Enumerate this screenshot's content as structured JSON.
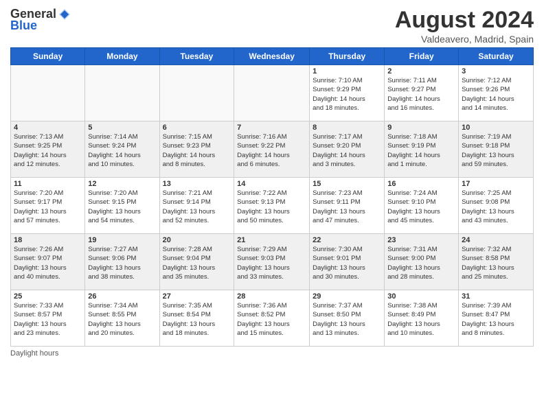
{
  "logo": {
    "general": "General",
    "blue": "Blue"
  },
  "title": "August 2024",
  "subtitle": "Valdeavero, Madrid, Spain",
  "days_of_week": [
    "Sunday",
    "Monday",
    "Tuesday",
    "Wednesday",
    "Thursday",
    "Friday",
    "Saturday"
  ],
  "footer": "Daylight hours",
  "weeks": [
    [
      {
        "day": "",
        "info": ""
      },
      {
        "day": "",
        "info": ""
      },
      {
        "day": "",
        "info": ""
      },
      {
        "day": "",
        "info": ""
      },
      {
        "day": "1",
        "info": "Sunrise: 7:10 AM\nSunset: 9:29 PM\nDaylight: 14 hours\nand 18 minutes."
      },
      {
        "day": "2",
        "info": "Sunrise: 7:11 AM\nSunset: 9:27 PM\nDaylight: 14 hours\nand 16 minutes."
      },
      {
        "day": "3",
        "info": "Sunrise: 7:12 AM\nSunset: 9:26 PM\nDaylight: 14 hours\nand 14 minutes."
      }
    ],
    [
      {
        "day": "4",
        "info": "Sunrise: 7:13 AM\nSunset: 9:25 PM\nDaylight: 14 hours\nand 12 minutes."
      },
      {
        "day": "5",
        "info": "Sunrise: 7:14 AM\nSunset: 9:24 PM\nDaylight: 14 hours\nand 10 minutes."
      },
      {
        "day": "6",
        "info": "Sunrise: 7:15 AM\nSunset: 9:23 PM\nDaylight: 14 hours\nand 8 minutes."
      },
      {
        "day": "7",
        "info": "Sunrise: 7:16 AM\nSunset: 9:22 PM\nDaylight: 14 hours\nand 6 minutes."
      },
      {
        "day": "8",
        "info": "Sunrise: 7:17 AM\nSunset: 9:20 PM\nDaylight: 14 hours\nand 3 minutes."
      },
      {
        "day": "9",
        "info": "Sunrise: 7:18 AM\nSunset: 9:19 PM\nDaylight: 14 hours\nand 1 minute."
      },
      {
        "day": "10",
        "info": "Sunrise: 7:19 AM\nSunset: 9:18 PM\nDaylight: 13 hours\nand 59 minutes."
      }
    ],
    [
      {
        "day": "11",
        "info": "Sunrise: 7:20 AM\nSunset: 9:17 PM\nDaylight: 13 hours\nand 57 minutes."
      },
      {
        "day": "12",
        "info": "Sunrise: 7:20 AM\nSunset: 9:15 PM\nDaylight: 13 hours\nand 54 minutes."
      },
      {
        "day": "13",
        "info": "Sunrise: 7:21 AM\nSunset: 9:14 PM\nDaylight: 13 hours\nand 52 minutes."
      },
      {
        "day": "14",
        "info": "Sunrise: 7:22 AM\nSunset: 9:13 PM\nDaylight: 13 hours\nand 50 minutes."
      },
      {
        "day": "15",
        "info": "Sunrise: 7:23 AM\nSunset: 9:11 PM\nDaylight: 13 hours\nand 47 minutes."
      },
      {
        "day": "16",
        "info": "Sunrise: 7:24 AM\nSunset: 9:10 PM\nDaylight: 13 hours\nand 45 minutes."
      },
      {
        "day": "17",
        "info": "Sunrise: 7:25 AM\nSunset: 9:08 PM\nDaylight: 13 hours\nand 43 minutes."
      }
    ],
    [
      {
        "day": "18",
        "info": "Sunrise: 7:26 AM\nSunset: 9:07 PM\nDaylight: 13 hours\nand 40 minutes."
      },
      {
        "day": "19",
        "info": "Sunrise: 7:27 AM\nSunset: 9:06 PM\nDaylight: 13 hours\nand 38 minutes."
      },
      {
        "day": "20",
        "info": "Sunrise: 7:28 AM\nSunset: 9:04 PM\nDaylight: 13 hours\nand 35 minutes."
      },
      {
        "day": "21",
        "info": "Sunrise: 7:29 AM\nSunset: 9:03 PM\nDaylight: 13 hours\nand 33 minutes."
      },
      {
        "day": "22",
        "info": "Sunrise: 7:30 AM\nSunset: 9:01 PM\nDaylight: 13 hours\nand 30 minutes."
      },
      {
        "day": "23",
        "info": "Sunrise: 7:31 AM\nSunset: 9:00 PM\nDaylight: 13 hours\nand 28 minutes."
      },
      {
        "day": "24",
        "info": "Sunrise: 7:32 AM\nSunset: 8:58 PM\nDaylight: 13 hours\nand 25 minutes."
      }
    ],
    [
      {
        "day": "25",
        "info": "Sunrise: 7:33 AM\nSunset: 8:57 PM\nDaylight: 13 hours\nand 23 minutes."
      },
      {
        "day": "26",
        "info": "Sunrise: 7:34 AM\nSunset: 8:55 PM\nDaylight: 13 hours\nand 20 minutes."
      },
      {
        "day": "27",
        "info": "Sunrise: 7:35 AM\nSunset: 8:54 PM\nDaylight: 13 hours\nand 18 minutes."
      },
      {
        "day": "28",
        "info": "Sunrise: 7:36 AM\nSunset: 8:52 PM\nDaylight: 13 hours\nand 15 minutes."
      },
      {
        "day": "29",
        "info": "Sunrise: 7:37 AM\nSunset: 8:50 PM\nDaylight: 13 hours\nand 13 minutes."
      },
      {
        "day": "30",
        "info": "Sunrise: 7:38 AM\nSunset: 8:49 PM\nDaylight: 13 hours\nand 10 minutes."
      },
      {
        "day": "31",
        "info": "Sunrise: 7:39 AM\nSunset: 8:47 PM\nDaylight: 13 hours\nand 8 minutes."
      }
    ]
  ]
}
